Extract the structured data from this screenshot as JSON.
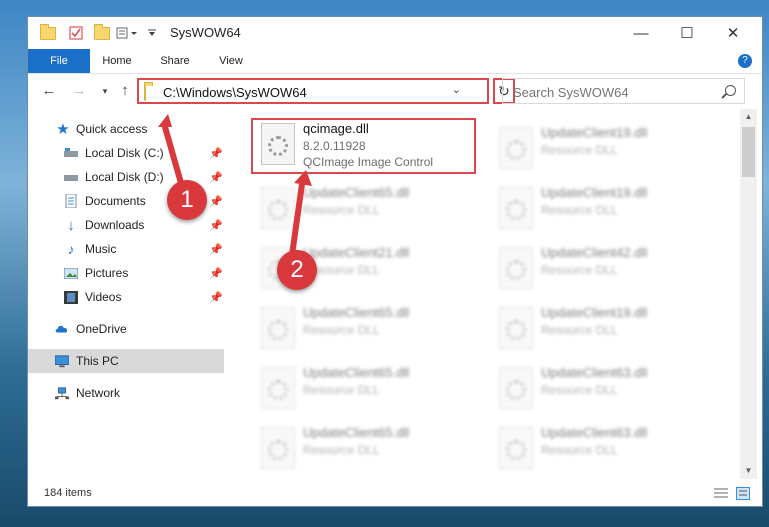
{
  "window": {
    "title": "SysWOW64"
  },
  "controls": {
    "minimize": "—",
    "maximize": "☐",
    "close": "✕"
  },
  "ribbon": {
    "tabs": [
      "File",
      "Home",
      "Share",
      "View"
    ],
    "help": "?"
  },
  "address": {
    "path": "C:\\Windows\\SysWOW64"
  },
  "search": {
    "placeholder": "Search SysWOW64"
  },
  "nav": {
    "quick_access": "Quick access",
    "items": [
      "Local Disk (C:)",
      "Local Disk (D:)",
      "Documents",
      "Downloads",
      "Music",
      "Pictures",
      "Videos"
    ],
    "onedrive": "OneDrive",
    "this_pc": "This PC",
    "network": "Network"
  },
  "selected_file": {
    "name": "qcimage.dll",
    "version": "8.2.0.11928",
    "description": "QCImage  Image Control"
  },
  "files_left": [
    {
      "name": "UpdateClient65.dll",
      "desc": "Resource DLL"
    },
    {
      "name": "UpdateClient21.dll",
      "desc": "Resource DLL"
    },
    {
      "name": "UpdateClient65.dll",
      "desc": "Resource DLL"
    },
    {
      "name": "UpdateClient65.dll",
      "desc": "Resource DLL"
    },
    {
      "name": "UpdateClient65.dll",
      "desc": "Resource DLL"
    }
  ],
  "files_right": [
    {
      "name": "UpdateClient19.dll",
      "desc": "Resource DLL"
    },
    {
      "name": "UpdateClient19.dll",
      "desc": "Resource DLL"
    },
    {
      "name": "UpdateClient42.dll",
      "desc": "Resource DLL"
    },
    {
      "name": "UpdateClient19.dll",
      "desc": "Resource DLL"
    },
    {
      "name": "UpdateClient63.dll",
      "desc": "Resource DLL"
    },
    {
      "name": "UpdateClient63.dll",
      "desc": "Resource DLL"
    }
  ],
  "status": {
    "count": "184 items"
  },
  "callouts": [
    "1",
    "2"
  ],
  "colors": {
    "accent": "#1a6fc9",
    "highlight": "#d9484c",
    "callout": "#d9383c"
  }
}
